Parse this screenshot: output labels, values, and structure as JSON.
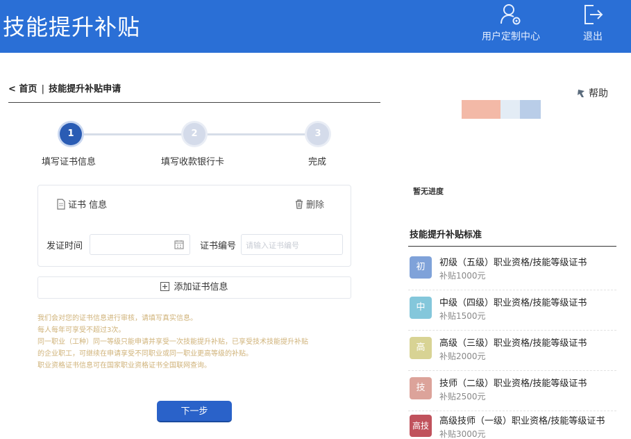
{
  "header": {
    "title": "技能提升补贴",
    "user_center_label": "用户定制中心",
    "exit_label": "退出"
  },
  "breadcrumb": {
    "home": "< 首页",
    "separator": "|",
    "current": "技能提升补贴申请"
  },
  "steps": [
    {
      "number": "1",
      "label": "填写证书信息",
      "state": "active"
    },
    {
      "number": "2",
      "label": "填写收款银行卡",
      "state": "todo"
    },
    {
      "number": "3",
      "label": "完成",
      "state": "todo"
    }
  ],
  "cert_card": {
    "title": "证书 信息",
    "delete_label": "删除",
    "issue_date_label": "发证时间",
    "cert_number_label": "证书编号",
    "cert_number_placeholder": "请输入证书编号"
  },
  "add_cert_label": "添加证书信息",
  "notes": [
    "我们会对您的证书信息进行审核，请填写真实信息。",
    "每人每年可享受不超过3次。",
    "同一职业（工种）同一等级只能申请并享受一次技能提升补贴，已享受技术技能提升补贴",
    "的企业职工，可继续在申请享受不同职业或同一职业更高等级的补贴。",
    "职业资格证书信息可在国家职业资格证书全国联网查询。"
  ],
  "next_button_label": "下一步",
  "right_panel": {
    "help_label": "帮助",
    "no_progress": "暂无进度",
    "standards_title": "技能提升补贴标准",
    "standards": [
      {
        "badge": "初",
        "color": "#7fa2d9",
        "name": "初级（五级）职业资格/技能等级证书",
        "amount": "补贴1000元"
      },
      {
        "badge": "中",
        "color": "#84c7db",
        "name": "中级（四级）职业资格/技能等级证书",
        "amount": "补贴1500元"
      },
      {
        "badge": "高",
        "color": "#d8d394",
        "name": "高级（三级）职业资格/技能等级证书",
        "amount": "补贴2000元"
      },
      {
        "badge": "技",
        "color": "#dca39a",
        "name": "技师（二级）职业资格/技能等级证书",
        "amount": "补贴2500元"
      },
      {
        "badge": "高技",
        "color": "#c0525c",
        "name": "高级技师（一级）职业资格/技能等级证书",
        "amount": "补贴3000元"
      }
    ]
  },
  "colors": {
    "header_bg": "#2a6fd6",
    "primary_button": "#2a62c9",
    "active_step": "#2a5cb4",
    "note_text": "#d0b37a"
  }
}
